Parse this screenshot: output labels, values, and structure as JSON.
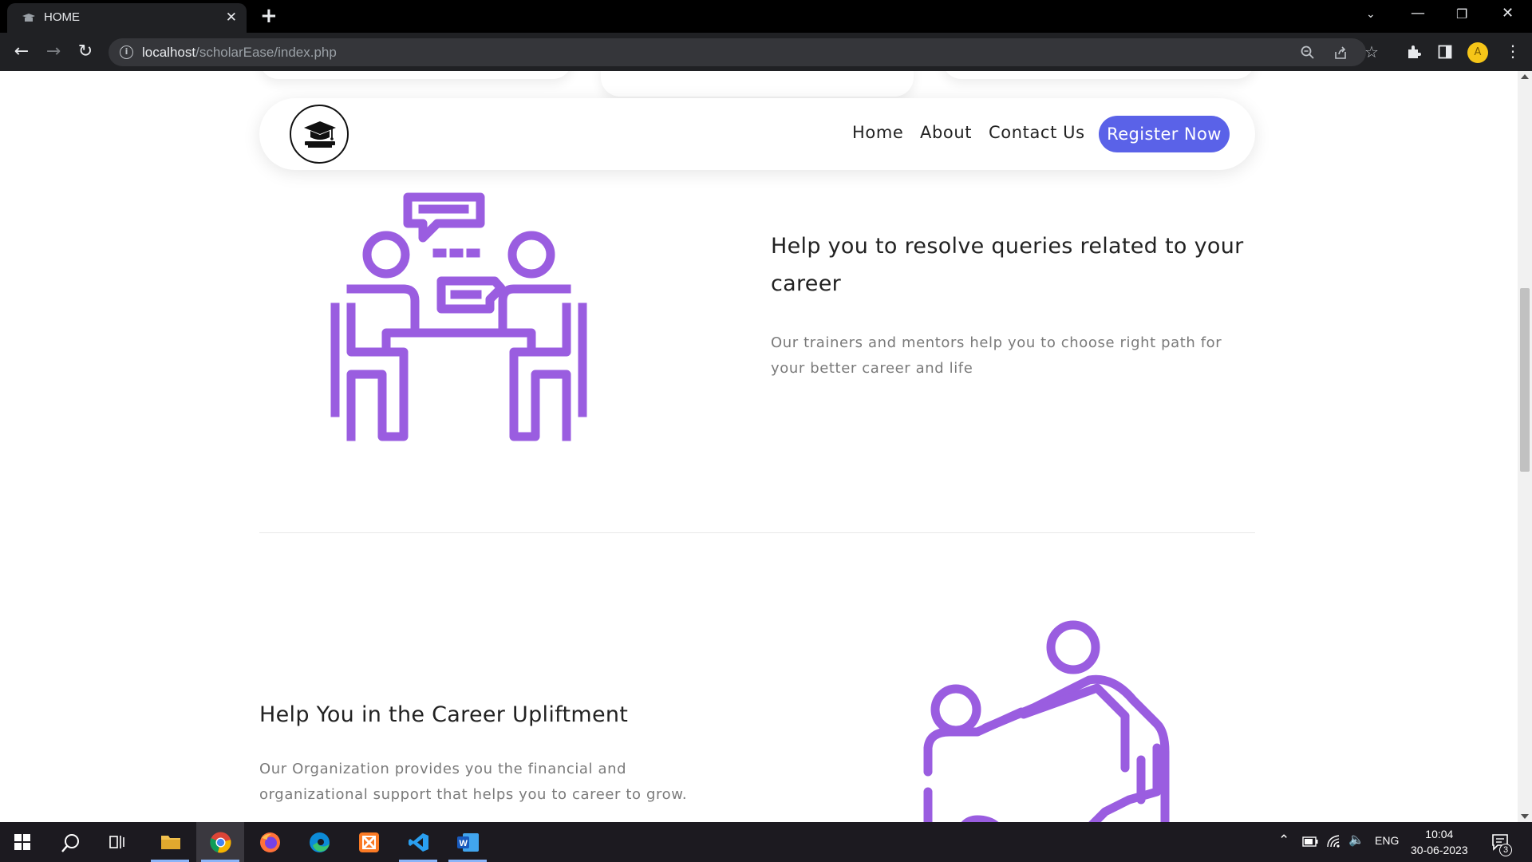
{
  "browser": {
    "tab_title": "HOME",
    "url_host": "localhost",
    "url_path": "/scholarEase/index.php",
    "profile_initial": "A"
  },
  "navbar": {
    "links": [
      "Home",
      "About",
      "Contact Us"
    ],
    "cta": "Register Now"
  },
  "features": [
    {
      "title": "Help you to resolve queries related to your career",
      "description": "Our trainers and mentors help you to choose right path for your better career and life"
    },
    {
      "title": "Help You in the Career Upliftment",
      "description": "Our Organization provides you the financial and organizational support that helps you to career to grow."
    }
  ],
  "taskbar": {
    "language": "ENG",
    "time": "10:04",
    "date": "30-06-2023",
    "notification_count": "3"
  },
  "colors": {
    "accent": "#5a62e8",
    "illustration": "#9a5de0"
  }
}
